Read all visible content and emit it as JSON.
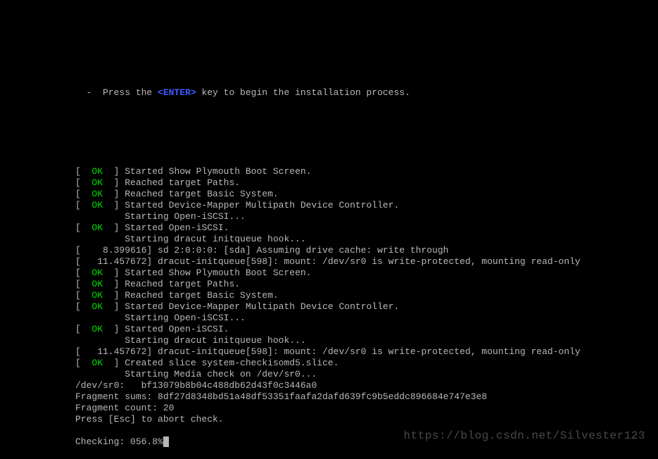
{
  "prompt": {
    "prefix": "  -  Press the ",
    "key": "<ENTER>",
    "suffix": " key to begin the installation process."
  },
  "bracket_open": "[  ",
  "bracket_close": "  ] ",
  "ok": "OK",
  "pad": "         ",
  "lines": [
    {
      "type": "ok",
      "text": "Started Show Plymouth Boot Screen."
    },
    {
      "type": "ok",
      "text": "Reached target Paths."
    },
    {
      "type": "ok",
      "text": "Reached target Basic System."
    },
    {
      "type": "ok",
      "text": "Started Device-Mapper Multipath Device Controller."
    },
    {
      "type": "pad",
      "text": "Starting Open-iSCSI..."
    },
    {
      "type": "ok",
      "text": "Started Open-iSCSI."
    },
    {
      "type": "pad",
      "text": "Starting dracut initqueue hook..."
    },
    {
      "type": "plain",
      "text": "[    8.399616] sd 2:0:0:0: [sda] Assuming drive cache: write through"
    },
    {
      "type": "plain",
      "text": "[   11.457672] dracut-initqueue[598]: mount: /dev/sr0 is write-protected, mounting read-only"
    },
    {
      "type": "ok",
      "text": "Started Show Plymouth Boot Screen."
    },
    {
      "type": "ok",
      "text": "Reached target Paths."
    },
    {
      "type": "ok",
      "text": "Reached target Basic System."
    },
    {
      "type": "ok",
      "text": "Started Device-Mapper Multipath Device Controller."
    },
    {
      "type": "pad",
      "text": "Starting Open-iSCSI..."
    },
    {
      "type": "ok",
      "text": "Started Open-iSCSI."
    },
    {
      "type": "pad",
      "text": "Starting dracut initqueue hook..."
    },
    {
      "type": "plain",
      "text": "[   11.457672] dracut-initqueue[598]: mount: /dev/sr0 is write-protected, mounting read-only"
    },
    {
      "type": "ok",
      "text": "Created slice system-checkisomd5.slice."
    },
    {
      "type": "pad",
      "text": "Starting Media check on /dev/sr0..."
    },
    {
      "type": "plain",
      "text": "/dev/sr0:   bf13079b8b04c488db62d43f0c3446a0"
    },
    {
      "type": "plain",
      "text": "Fragment sums: 8df27d8348bd51a48df53351faafa2dafd639fc9b5eddc896684e747e3e8"
    },
    {
      "type": "plain",
      "text": "Fragment count: 20"
    },
    {
      "type": "plain",
      "text": "Press [Esc] to abort check."
    }
  ],
  "checking": {
    "label": "Checking: ",
    "value": "056.8%",
    "cursor": "_"
  },
  "watermark": "https://blog.csdn.net/Silvester123"
}
